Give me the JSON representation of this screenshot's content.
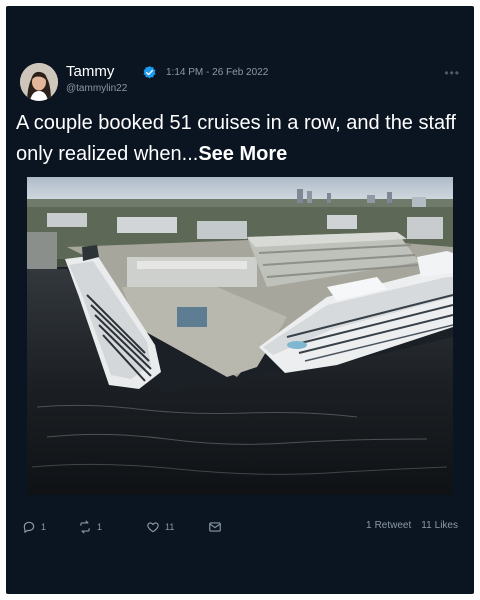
{
  "tweet": {
    "author_name": "Tammy",
    "author_handle": "@tammylin22",
    "timestamp": "1:14 PM - 26 Feb 2022",
    "verified_icon": "verified-badge-icon",
    "more_icon": "more-options-icon",
    "text": "A couple booked 51 cruises in a row, and the staff only realized when...",
    "see_more_label": "See More",
    "image_alt_icon": "cruise-ships-photo"
  },
  "actions": {
    "reply_count": "1",
    "retweet_count": "1",
    "like_count": "11",
    "reply_icon": "reply-icon",
    "retweet_icon": "retweet-icon",
    "like_icon": "heart-icon",
    "share_icon": "share-icon"
  },
  "stats": {
    "retweets_num": "1",
    "retweets_label": "Retweet",
    "likes_num": "11",
    "likes_label": "Likes"
  },
  "colors": {
    "card_background": "#0b1522",
    "text_primary": "#ffffff",
    "text_secondary": "#8b98a5",
    "verified_blue": "#1d9bf0"
  }
}
